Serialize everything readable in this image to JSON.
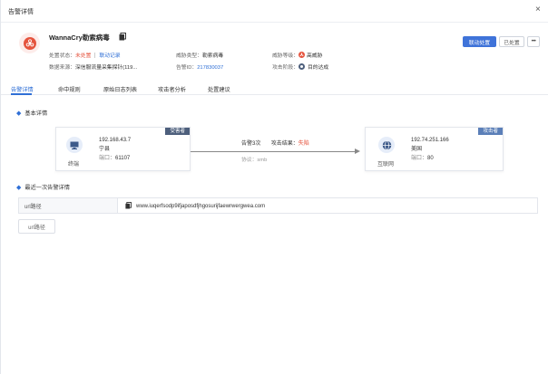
{
  "dialog": {
    "title": "告警详情",
    "close_glyph": "×"
  },
  "alert": {
    "name": "WannaCry勒索病毒"
  },
  "meta": {
    "status_label": "处置状态：",
    "status_value": "未处置",
    "status_link": "联动记录",
    "threat_type_label": "威胁类型：",
    "threat_type_value": "勒索病毒",
    "threat_level_label": "威胁等级：",
    "threat_level_value": "高威胁",
    "source_label": "数据来源：",
    "source_value": "深信服流量采集探针(119...",
    "alert_id_label": "告警ID：",
    "alert_id_value": "217830037",
    "attack_stage_label": "攻击阶段：",
    "attack_stage_value": "目的达成"
  },
  "actions": {
    "primary": "联动处置",
    "secondary": "已处置",
    "more": "•••"
  },
  "tabs": [
    {
      "label": "告警详情"
    },
    {
      "label": "命中规则"
    },
    {
      "label": "原始日志列表"
    },
    {
      "label": "攻击者分析"
    },
    {
      "label": "处置建议"
    }
  ],
  "basic": {
    "section_title": "基本详情",
    "victim": {
      "tag": "受害者",
      "ip": "192.168.43.7",
      "location": "宁县",
      "port_label": "端口：",
      "port": "61107",
      "type_label": "终端"
    },
    "attacker": {
      "tag": "攻击者",
      "ip": "192.74.251.166",
      "location": "美国",
      "port_label": "端口：",
      "port": "80",
      "type_label": "互联网"
    },
    "flow": {
      "count_text": "告警3次",
      "result_label": "攻击结果：",
      "result_value": "失陷",
      "protocol_label": "协议：",
      "protocol_value": "smb"
    }
  },
  "recent": {
    "section_title": "最近一次告警详情",
    "url_label": "url路径",
    "url_value": "www.iuqerfsodp9ifjaposdfjhgosurijfaewrwergwea.com",
    "url_button": "url路径"
  },
  "colors": {
    "accent": "#2f6fd6",
    "danger": "#e5533d",
    "primary_button": "#3f73d9"
  }
}
